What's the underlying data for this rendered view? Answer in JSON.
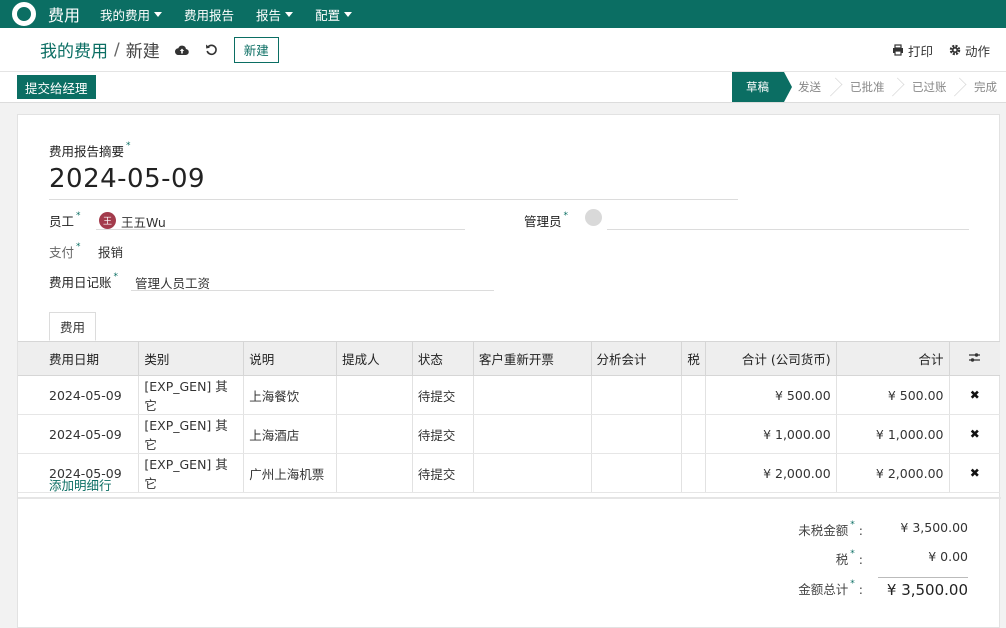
{
  "nav": {
    "app_name": "费用",
    "menu": [
      "我的费用",
      "费用报告",
      "报告",
      "配置"
    ]
  },
  "control": {
    "breadcrumb_parent": "我的费用",
    "breadcrumb_sep": "/",
    "breadcrumb_current": "新建",
    "new_button": "新建",
    "print": "打印",
    "action": "动作"
  },
  "status": {
    "submit_button": "提交给经理",
    "steps": [
      "草稿",
      "发送",
      "已批准",
      "已过账",
      "完成"
    ],
    "active_step": "草稿"
  },
  "form": {
    "summary_label": "费用报告摘要",
    "summary_value": "2024-05-09",
    "employee_label": "员工",
    "employee_avatar": "王",
    "employee_value": "王五Wu",
    "manager_label": "管理员",
    "payment_label": "支付",
    "payment_value": "报销",
    "journal_label": "费用日记账",
    "journal_value": "管理人员工资",
    "required_mark": "*"
  },
  "tab": {
    "label": "费用"
  },
  "table": {
    "headers": [
      "费用日期",
      "类别",
      "说明",
      "提成人",
      "状态",
      "客户重新开票",
      "分析会计",
      "税",
      "合计 (公司货币)",
      "合计"
    ],
    "rows": [
      [
        "2024-05-09",
        "[EXP_GEN] 其它",
        "上海餐饮",
        "",
        "待提交",
        "",
        "",
        "",
        "¥ 500.00",
        "¥ 500.00"
      ],
      [
        "2024-05-09",
        "[EXP_GEN] 其它",
        "上海酒店",
        "",
        "待提交",
        "",
        "",
        "",
        "¥ 1,000.00",
        "¥ 1,000.00"
      ],
      [
        "2024-05-09",
        "[EXP_GEN] 其它",
        "广州上海机票",
        "",
        "待提交",
        "",
        "",
        "",
        "¥ 2,000.00",
        "¥ 2,000.00"
      ]
    ],
    "add_line": "添加明细行",
    "delete_icon": "✖"
  },
  "totals": {
    "untaxed_label": "未税金额",
    "untaxed_value": "¥ 3,500.00",
    "tax_label": "税",
    "tax_value": "¥ 0.00",
    "total_label": "金额总计",
    "total_value": "¥ 3,500.00",
    "colon": ":"
  },
  "colors": {
    "primary": "#0b6e63",
    "avatar": "#a33b4c"
  }
}
